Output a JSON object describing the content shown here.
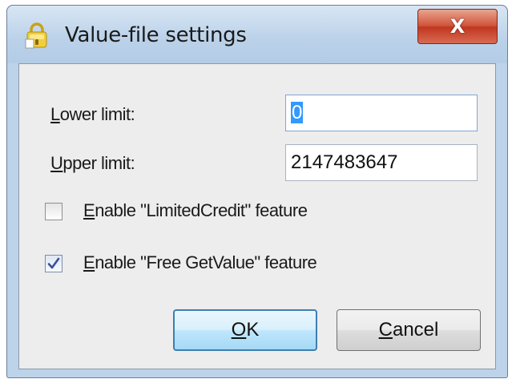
{
  "window": {
    "title": "Value-file settings",
    "close_glyph": "X"
  },
  "fields": {
    "lower_limit": {
      "label_access_key": "L",
      "label_rest": "ower limit:",
      "value": "0"
    },
    "upper_limit": {
      "label_access_key": "U",
      "label_rest": "pper limit:",
      "value": "2147483647"
    }
  },
  "options": {
    "limited_credit": {
      "label_access_key": "E",
      "label_rest": "nable \"LimitedCredit\" feature",
      "checked": false
    },
    "free_get_value": {
      "label_access_key": "E",
      "label_rest": "nable \"Free GetValue\" feature",
      "checked": true
    }
  },
  "buttons": {
    "ok": {
      "label_access_key": "O",
      "label_rest": "K"
    },
    "cancel": {
      "label_access_key": "C",
      "label_rest": "ancel"
    }
  },
  "colors": {
    "title_bar": "#bad1e9",
    "close_button": "#c1361f",
    "client_background": "#ededed",
    "default_button_border": "#3c7fb1",
    "selection_highlight": "#3399ff"
  },
  "icons": {
    "app": "padlock-icon",
    "close": "close-icon",
    "check": "checkmark-icon"
  }
}
